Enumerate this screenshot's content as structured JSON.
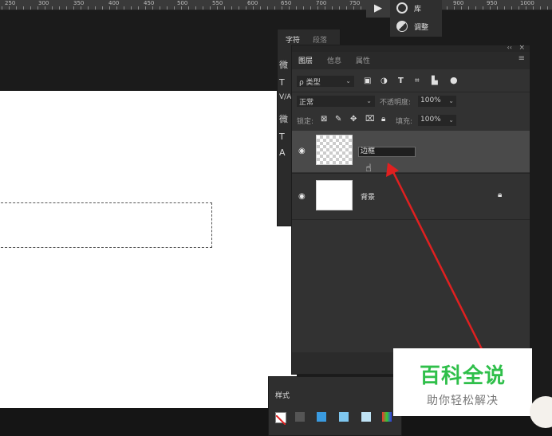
{
  "ruler": {
    "ticks": [
      "250",
      "300",
      "350",
      "400",
      "450",
      "500",
      "550",
      "600",
      "650",
      "700",
      "750",
      "900",
      "950",
      "1000"
    ]
  },
  "library": {
    "play_icon": "play-icon",
    "items": [
      {
        "icon": "creative-cloud-library-icon",
        "label": "库"
      },
      {
        "icon": "adjustments-icon",
        "label": "调整"
      }
    ]
  },
  "character_panel": {
    "tabs": [
      "字符",
      "段落"
    ],
    "glyphs": [
      "微",
      "T",
      "V/A",
      "微",
      "T",
      "A"
    ]
  },
  "layers_panel": {
    "tabs": [
      "图层",
      "信息",
      "属性"
    ],
    "filter": {
      "label": "ρ 类型",
      "icons": [
        "image-filter-icon",
        "adjustment-filter-icon",
        "type-filter-icon",
        "shape-filter-icon",
        "smart-object-filter-icon"
      ]
    },
    "blend_mode": "正常",
    "opacity_label": "不透明度:",
    "opacity_value": "100%",
    "lock_label": "锁定:",
    "fill_label": "填充:",
    "fill_value": "100%",
    "layers": [
      {
        "name": "边框",
        "thumbnail": "transparent",
        "selected": true,
        "editing": true
      },
      {
        "name": "背景",
        "thumbnail": "white",
        "locked": true
      }
    ]
  },
  "styles_panel": {
    "title": "样式"
  },
  "watermark": {
    "title": "百科全说",
    "subtitle": "助你轻松解决"
  },
  "colors": {
    "annotation_arrow": "#e02020",
    "canvas": "#ffffff",
    "panel": "#323232",
    "watermark_green": "#2fbf4a"
  }
}
